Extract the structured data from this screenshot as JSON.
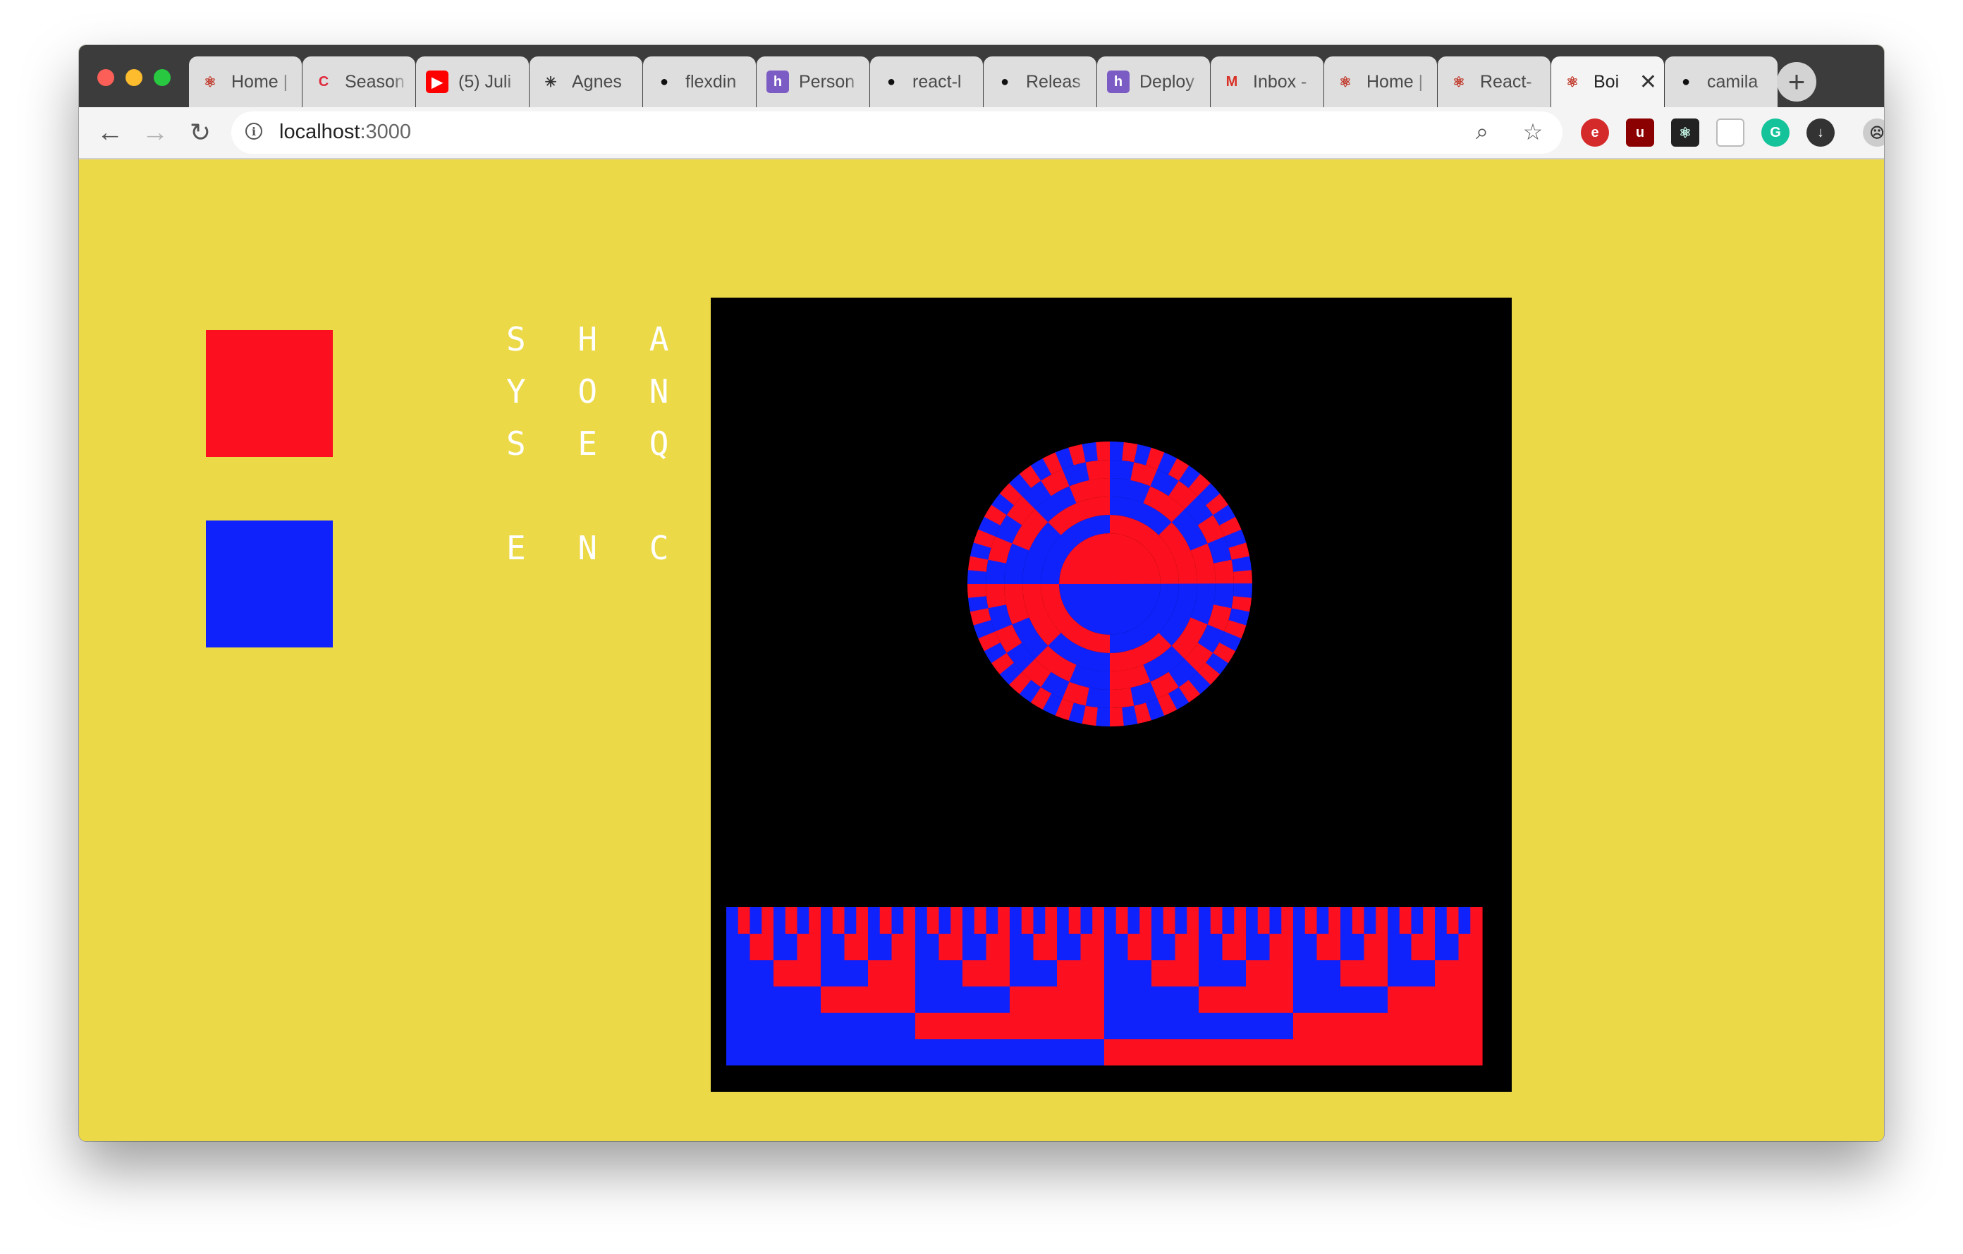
{
  "browser": {
    "tabs": [
      {
        "title": "Home |",
        "icon": "react-logo-icon",
        "active": false
      },
      {
        "title": "Season",
        "icon": "c-logo-icon",
        "active": false
      },
      {
        "title": "(5) Juli",
        "icon": "youtube-icon",
        "active": false
      },
      {
        "title": "Agnes",
        "icon": "asterisk-logo-icon",
        "active": false
      },
      {
        "title": "flexdin",
        "icon": "github-icon",
        "active": false
      },
      {
        "title": "Person",
        "icon": "heroku-icon",
        "active": false
      },
      {
        "title": "react-l",
        "icon": "github-icon",
        "active": false
      },
      {
        "title": "Releas",
        "icon": "github-icon",
        "active": false
      },
      {
        "title": "Deploy",
        "icon": "heroku-icon",
        "active": false
      },
      {
        "title": "Inbox -",
        "icon": "gmail-icon",
        "active": false
      },
      {
        "title": "Home |",
        "icon": "react-logo-icon",
        "active": false
      },
      {
        "title": "React-",
        "icon": "react-logo-icon",
        "active": false
      },
      {
        "title": "Boi",
        "icon": "react-logo-icon",
        "active": true,
        "close": "✕"
      },
      {
        "title": "camila",
        "icon": "github-icon",
        "active": false
      }
    ],
    "new_tab": "+",
    "url_host": "localhost",
    "url_port": ":3000"
  },
  "page": {
    "colors": {
      "background": "#ecd947",
      "red": "#fc0f1e",
      "blue": "#0f22fc",
      "canvas": "#000000"
    },
    "title_lines": [
      "S H A O",
      "Y O N G",
      "S E Q U",
      "",
      "E N C E"
    ]
  }
}
